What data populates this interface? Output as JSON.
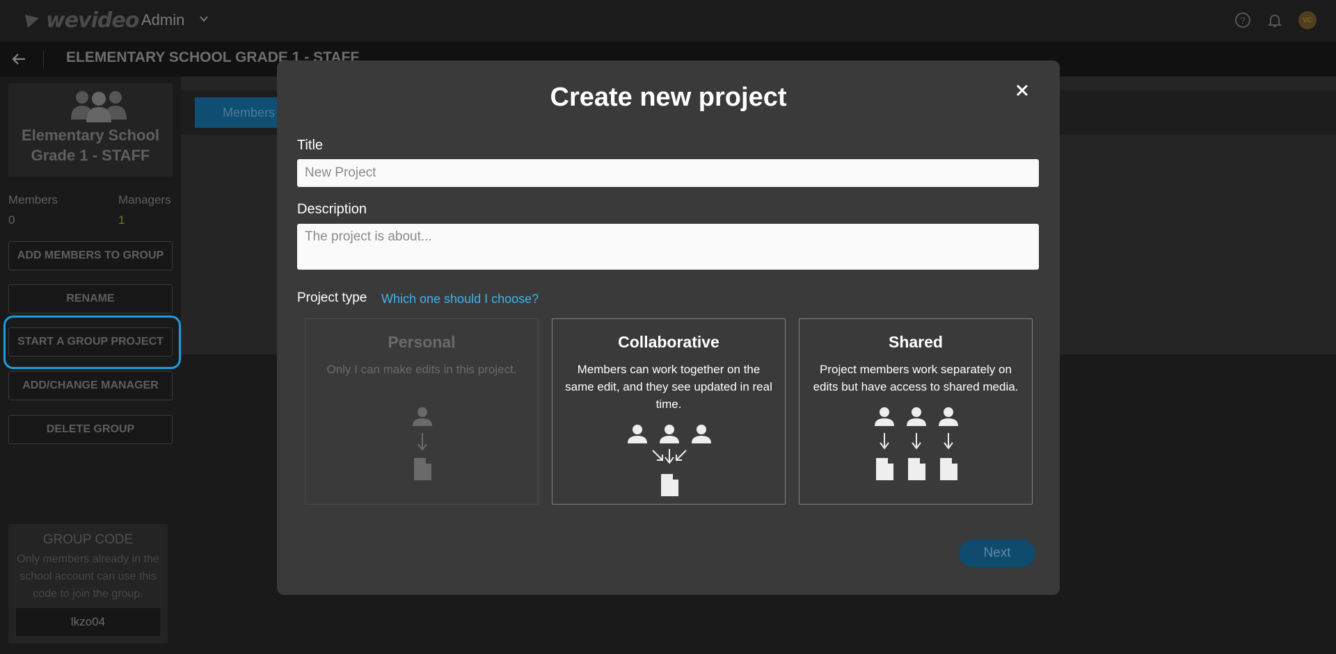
{
  "header": {
    "brand": "wevideo",
    "role_menu": "Admin",
    "avatar_initials": "VC"
  },
  "subheader": {
    "title": "ELEMENTARY SCHOOL GRADE 1 - STAFF"
  },
  "sidebar": {
    "group_name": "Elementary School Grade 1 - STAFF",
    "members_label": "Members",
    "members_value": "0",
    "managers_label": "Managers",
    "managers_value": "1",
    "buttons": [
      "ADD MEMBERS TO GROUP",
      "RENAME",
      "START A GROUP PROJECT",
      "ADD/CHANGE MANAGER",
      "DELETE GROUP"
    ],
    "group_code": {
      "title": "GROUP CODE",
      "description": "Only members already in the school account can use this code to join the group.",
      "code": "lkzo04"
    }
  },
  "main": {
    "tab_members": "Members"
  },
  "modal": {
    "title": "Create new project",
    "title_label": "Title",
    "title_placeholder": "New Project",
    "description_label": "Description",
    "description_placeholder": "The project is about...",
    "project_type_label": "Project type",
    "help_link": "Which one should I choose?",
    "types": [
      {
        "title": "Personal",
        "description": "Only I can make edits in this project.",
        "enabled": false
      },
      {
        "title": "Collaborative",
        "description": "Members can work together on the same edit, and they see updated in real time.",
        "enabled": true
      },
      {
        "title": "Shared",
        "description": "Project members work separately on edits but have access to shared media.",
        "enabled": true
      }
    ],
    "next_label": "Next"
  },
  "colors": {
    "accent": "#1a9ee0",
    "link": "#3eb4e8",
    "modal_bg": "#3a3a3a",
    "button_disabled": "#0e4b6c"
  }
}
